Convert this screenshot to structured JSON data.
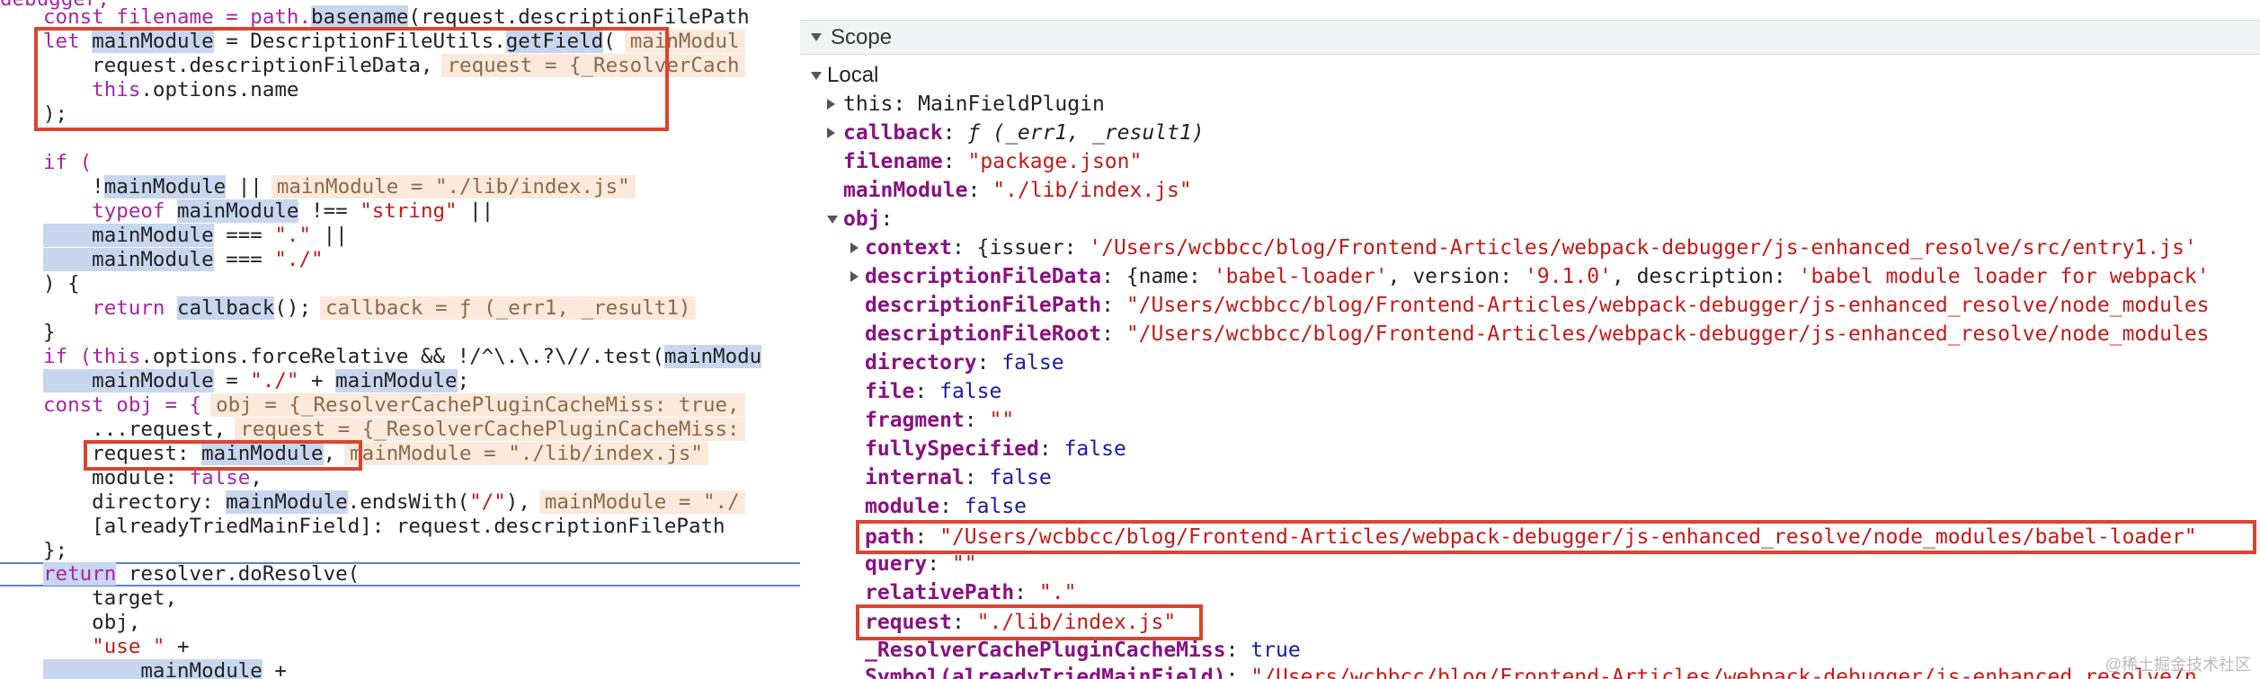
{
  "code": {
    "line0": "debugger;",
    "line1_a": "const filename = path.",
    "line1_b": "basename",
    "line1_c": "(request.descriptionFilePath",
    "line2_let": "let ",
    "line2_var": "mainModule",
    "line2_mid": " = DescriptionFileUtils.",
    "line2_fn": "getField",
    "line2_end": "(",
    "line2_inline": "mainModul",
    "line3_a": "    request.descriptionFileData,",
    "line3_inline": "request = {_ResolverCach",
    "line4_this": "    this",
    "line4_rest": ".options.name",
    "line5": ");",
    "line7": "if (",
    "line8_a": "    !",
    "line8_var": "mainModule",
    "line8_b": " ||",
    "line8_inline": "mainModule = \"./lib/index.js\"",
    "line9_a": "    typeof ",
    "line9_var": "mainModule",
    "line9_b": " !== ",
    "line9_str": "\"string\"",
    "line9_c": " ||",
    "line10_var": "    mainModule",
    "line10_b": " === ",
    "line10_str": "\".\"",
    "line10_c": " ||",
    "line11_var": "    mainModule",
    "line11_b": " === ",
    "line11_str": "\"./\"",
    "line12": ") {",
    "line13_a": "    return ",
    "line13_fn": "callback",
    "line13_b": "();",
    "line13_inline": "callback = ƒ (_err1, _result1)",
    "line14": "}",
    "line15_a": "if (",
    "line15_this": "this",
    "line15_b": ".options.forceRelative && !/^\\.\\.?\\//.test(",
    "line15_var": "mainModu",
    "line16_var": "    mainModule",
    "line16_b": " = ",
    "line16_str": "\"./\"",
    "line16_c": " + ",
    "line16_var2": "mainModule",
    "line16_d": ";",
    "line17_a": "const obj = {",
    "line17_inline": "obj = {_ResolverCachePluginCacheMiss: true,",
    "line18_a": "    ...request,",
    "line18_inline": "request = {_ResolverCachePluginCacheMiss:",
    "line19_a": "    request: ",
    "line19_var": "mainModule",
    "line19_b": ",",
    "line19_inline": "mainModule = \"./lib/index.js\"",
    "line20_a": "    module: ",
    "line20_kw": "false",
    "line20_b": ",",
    "line21_a": "    directory: ",
    "line21_var": "mainModule",
    "line21_b": ".endsWith(",
    "line21_str": "\"/\"",
    "line21_c": "),",
    "line21_inline": "mainModule = \"./",
    "line22": "    [alreadyTriedMainField]: request.descriptionFilePath",
    "line23": "};",
    "line24_kw": "return",
    "line24_b": " resolver.doResolve(",
    "line25": "    target,",
    "line26": "    obj,",
    "line27_str": "    \"use \"",
    "line27_b": " +",
    "line28_var": "        mainModule",
    "line28_b": " +"
  },
  "scope": {
    "header_title": "Scope",
    "local_label": "Local",
    "this_name": "this",
    "this_value": "MainFieldPlugin",
    "callback_name": "callback",
    "callback_value": "ƒ (_err1, _result1)",
    "filename_name": "filename",
    "filename_value": "\"package.json\"",
    "mainModule_name": "mainModule",
    "mainModule_value": "\"./lib/index.js\"",
    "obj_name": "obj",
    "context_name": "context",
    "context_value_a": "{issuer: ",
    "context_value_b": "'/Users/wcbbcc/blog/Frontend-Articles/webpack-debugger/js-enhanced_resolve/src/entry1.js'",
    "dfd_name": "descriptionFileData",
    "dfd_value_a": "{name: ",
    "dfd_value_b": "'babel-loader'",
    "dfd_value_c": ", version: ",
    "dfd_value_d": "'9.1.0'",
    "dfd_value_e": ", description: ",
    "dfd_value_f": "'babel module loader for webpack'",
    "dfp_name": "descriptionFilePath",
    "dfp_value": "\"/Users/wcbbcc/blog/Frontend-Articles/webpack-debugger/js-enhanced_resolve/node_modules",
    "dfr_name": "descriptionFileRoot",
    "dfr_value": "\"/Users/wcbbcc/blog/Frontend-Articles/webpack-debugger/js-enhanced_resolve/node_modules",
    "directory_name": "directory",
    "directory_value": "false",
    "file_name": "file",
    "file_value": "false",
    "fragment_name": "fragment",
    "fragment_value": "\"\"",
    "fullySpecified_name": "fullySpecified",
    "fullySpecified_value": "false",
    "internal_name": "internal",
    "internal_value": "false",
    "module_name": "module",
    "module_value": "false",
    "path_name": "path",
    "path_value": "\"/Users/wcbbcc/blog/Frontend-Articles/webpack-debugger/js-enhanced_resolve/node_modules/babel-loader\"",
    "query_name": "query",
    "query_value": "\"\"",
    "relativePath_name": "relativePath",
    "relativePath_value": "\".\"",
    "request_name": "request",
    "request_value": "\"./lib/index.js\"",
    "cachemiss_name": "_ResolverCachePluginCacheMiss",
    "cachemiss_value": "true",
    "symbol_name": "Symbol(alreadyTriedMainField)",
    "symbol_value": "\"/Users/wcbbcc/blog/Frontend-Articles/webpack-debugger/js-enhanced_resolve/n"
  },
  "watermark": "@稀土掘金技术社区"
}
